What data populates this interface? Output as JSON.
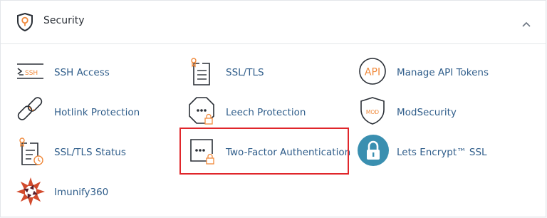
{
  "section": {
    "title": "Security",
    "icon": "shield-icon",
    "toggle_icon": "chevron-up-icon"
  },
  "items": [
    {
      "label": "SSH Access",
      "icon": "terminal-ssh-icon"
    },
    {
      "label": "SSL/TLS",
      "icon": "certificate-icon"
    },
    {
      "label": "Manage API Tokens",
      "icon": "api-icon"
    },
    {
      "label": "Hotlink Protection",
      "icon": "broken-link-icon"
    },
    {
      "label": "Leech Protection",
      "icon": "octagon-password-lock-icon"
    },
    {
      "label": "ModSecurity",
      "icon": "mod-shield-icon"
    },
    {
      "label": "SSL/TLS Status",
      "icon": "certificate-clock-icon"
    },
    {
      "label": "Two-Factor Authentication",
      "icon": "password-lock-icon"
    },
    {
      "label": "Lets Encrypt™ SSL",
      "icon": "lets-encrypt-padlock-icon"
    },
    {
      "label": "Imunify360",
      "icon": "imunify360-logo-icon"
    }
  ],
  "highlighted_item": "Two-Factor Authentication",
  "colors": {
    "label": "#2f5d8a",
    "icon_dark": "#2a2f36",
    "icon_accent": "#f08a3c",
    "highlight": "#e0262b",
    "lets_encrypt": "#3a8fb0"
  }
}
